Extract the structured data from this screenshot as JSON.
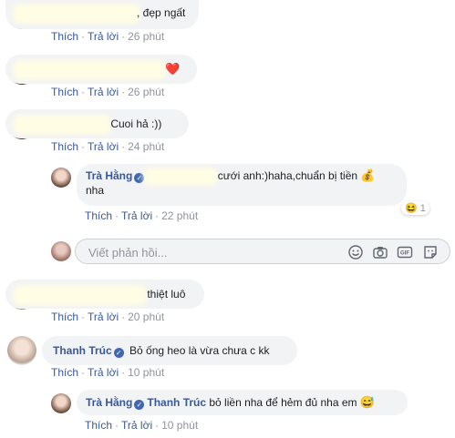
{
  "comments": [
    {
      "text": ", đẹp ngất",
      "actions": {
        "like": "Thích",
        "reply": "Trả lời",
        "time": "26 phút"
      }
    },
    {
      "text": "",
      "emoji": "❤️",
      "actions": {
        "like": "Thích",
        "reply": "Trả lời",
        "time": "26 phút"
      }
    },
    {
      "text": "Cuoi hả :))",
      "actions": {
        "like": "Thích",
        "reply": "Trả lời",
        "time": "24 phút"
      }
    },
    {
      "author": "Trà Hằng",
      "text": "cưới anh:)haha,chuẩn bị tiền",
      "text2": "nha",
      "emoji": "💰",
      "reaction": {
        "emoji": "😆",
        "count": "1"
      },
      "actions": {
        "like": "Thích",
        "reply": "Trả lời",
        "time": "22 phút"
      }
    },
    {
      "text": "thiệt luô",
      "actions": {
        "like": "Thích",
        "reply": "Trả lời",
        "time": "20 phút"
      }
    },
    {
      "author": "Thanh Trúc",
      "text": "Bỏ ống heo là vừa chưa c kk",
      "actions": {
        "like": "Thích",
        "reply": "Trả lời",
        "time": "10 phút"
      }
    },
    {
      "author": "Trà Hằng",
      "mention": "Thanh Trúc",
      "text": "bỏ liền nha để hẻm đủ nha em",
      "emoji": "😅",
      "actions": {
        "like": "Thích",
        "reply": "Trả lời",
        "time": "10 phút"
      }
    }
  ],
  "reply_box": {
    "placeholder": "Viết phản hồi..."
  },
  "icons": {
    "verified": "verified-badge-icon",
    "tools": [
      "emoji-icon",
      "camera-icon",
      "gif-icon",
      "sticker-icon"
    ]
  },
  "colors": {
    "link": "#385898",
    "meta": "#90949c",
    "bubble": "#f2f3f5",
    "verified": "#4267b2"
  }
}
